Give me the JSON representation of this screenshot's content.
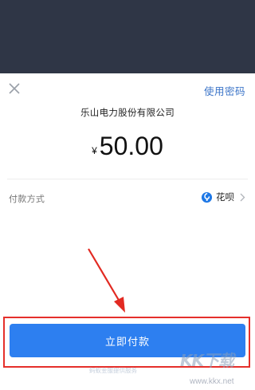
{
  "header": {
    "use_password_label": "使用密码",
    "close_icon": "close-icon"
  },
  "payment": {
    "merchant_name": "乐山电力股份有限公司",
    "currency_symbol": "¥",
    "amount": "50.00"
  },
  "method": {
    "label": "付款方式",
    "value": "花呗",
    "icon": "huabei-icon"
  },
  "actions": {
    "pay_now_label": "立即付款"
  },
  "footer": {
    "note": "蚂蚁金服提供服务"
  },
  "watermark": {
    "logo": "KK下载",
    "url": "www.kkx.net"
  },
  "colors": {
    "top_band": "#2f3646",
    "link": "#3b74c8",
    "button": "#2d7ff0",
    "annotation": "#e5302b"
  }
}
